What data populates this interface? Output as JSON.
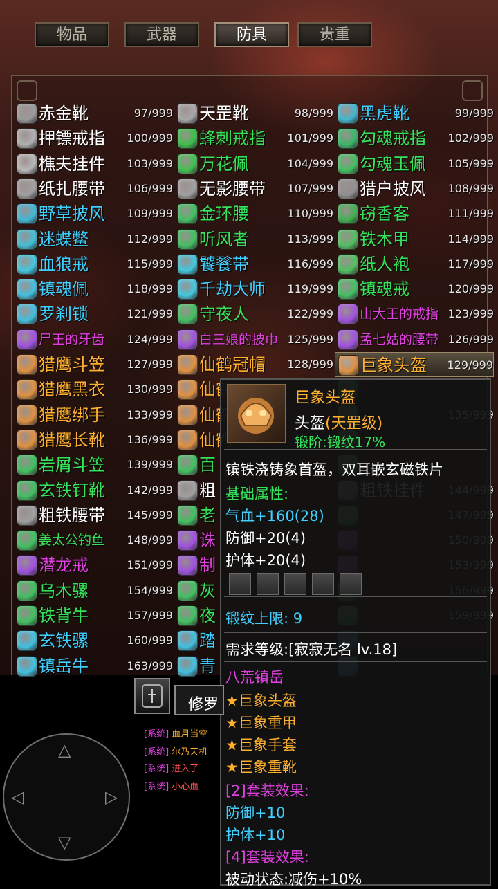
{
  "tabs": [
    "物品",
    "武器",
    "防具",
    "贵重"
  ],
  "active_tab": 2,
  "items": [
    {
      "name": "赤金靴",
      "count": "97/999",
      "color": "#ffffff",
      "icon": "#9a9a9a"
    },
    {
      "name": "天罡靴",
      "count": "98/999",
      "color": "#ffffff",
      "icon": "#a8a8a8"
    },
    {
      "name": "黑虎靴",
      "count": "99/999",
      "color": "#3fd0ff",
      "icon": "#3fb8d0"
    },
    {
      "name": "押镖戒指",
      "count": "100/999",
      "color": "#ffffff",
      "icon": "#b0b0b0"
    },
    {
      "name": "蜂刺戒指",
      "count": "101/999",
      "color": "#35e35a",
      "icon": "#39c048"
    },
    {
      "name": "勾魂戒指",
      "count": "102/999",
      "color": "#35e35a",
      "icon": "#36b868"
    },
    {
      "name": "樵夫挂件",
      "count": "103/999",
      "color": "#ffffff",
      "icon": "#b8b8b8"
    },
    {
      "name": "万花佩",
      "count": "104/999",
      "color": "#35e35a",
      "icon": "#40c050"
    },
    {
      "name": "勾魂玉佩",
      "count": "105/999",
      "color": "#35e35a",
      "icon": "#40c060"
    },
    {
      "name": "纸扎腰带",
      "count": "106/999",
      "color": "#ffffff",
      "icon": "#a0a0a0"
    },
    {
      "name": "无影腰带",
      "count": "107/999",
      "color": "#ffffff",
      "icon": "#a0a0a0"
    },
    {
      "name": "猎户披风",
      "count": "108/999",
      "color": "#ffffff",
      "icon": "#909090"
    },
    {
      "name": "野草披风",
      "count": "109/999",
      "color": "#3fd0ff",
      "icon": "#40b8d8"
    },
    {
      "name": "金环腰",
      "count": "110/999",
      "color": "#35e35a",
      "icon": "#40c060"
    },
    {
      "name": "窃香客",
      "count": "111/999",
      "color": "#35e35a",
      "icon": "#40b050"
    },
    {
      "name": "迷蝶鳖",
      "count": "112/999",
      "color": "#3fd0ff",
      "icon": "#40c0d8"
    },
    {
      "name": "听风者",
      "count": "113/999",
      "color": "#35e35a",
      "icon": "#40c060"
    },
    {
      "name": "铁木甲",
      "count": "114/999",
      "color": "#35e35a",
      "icon": "#50c060"
    },
    {
      "name": "血狼戒",
      "count": "115/999",
      "color": "#3fd0ff",
      "icon": "#40c8e0"
    },
    {
      "name": "饕餮带",
      "count": "116/999",
      "color": "#3fd0ff",
      "icon": "#40c8e0"
    },
    {
      "name": "纸人袍",
      "count": "117/999",
      "color": "#35e35a",
      "icon": "#50c060"
    },
    {
      "name": "镇魂佩",
      "count": "118/999",
      "color": "#3fd0ff",
      "icon": "#40c0e0"
    },
    {
      "name": "千劫大师",
      "count": "119/999",
      "color": "#3fd0ff",
      "icon": "#40c8e0"
    },
    {
      "name": "镇魂戒",
      "count": "120/999",
      "color": "#35e35a",
      "icon": "#40c060"
    },
    {
      "name": "罗刹锁",
      "count": "121/999",
      "color": "#3fd0ff",
      "icon": "#40c0e0"
    },
    {
      "name": "守夜人",
      "count": "122/999",
      "color": "#35e35a",
      "icon": "#40c060"
    },
    {
      "name": "山大王的戒指",
      "count": "123/999",
      "color": "#e040e0",
      "icon": "#a050e0"
    },
    {
      "name": "尸王的牙齿",
      "count": "124/999",
      "color": "#e040e0",
      "icon": "#a050e0"
    },
    {
      "name": "白三娘的披巾",
      "count": "125/999",
      "color": "#e040e0",
      "icon": "#a050e0"
    },
    {
      "name": "孟七姑的腰带",
      "count": "126/999",
      "color": "#e040e0",
      "icon": "#a050e0"
    },
    {
      "name": "猎鹰斗笠",
      "count": "127/999",
      "color": "#ffb030",
      "icon": "#e09040"
    },
    {
      "name": "仙鹤冠帽",
      "count": "128/999",
      "color": "#ffb030",
      "icon": "#e09040"
    },
    {
      "name": "巨象头盔",
      "count": "129/999",
      "color": "#ffb030",
      "icon": "#e09040"
    },
    {
      "name": "猎鹰黑衣",
      "count": "130/999",
      "color": "#ffb030",
      "icon": "#e09040"
    },
    {
      "name": "仙鹤",
      "count": "",
      "color": "#ffb030",
      "icon": "#e09040"
    },
    {
      "name": "",
      "count": "",
      "color": "#35e35a",
      "icon": "#40c060"
    },
    {
      "name": "猎鹰绑手",
      "count": "133/999",
      "color": "#ffb030",
      "icon": "#e09040"
    },
    {
      "name": "仙鹤",
      "count": "",
      "color": "#ffb030",
      "icon": "#e09040"
    },
    {
      "name": "",
      "count": "135/999",
      "color": "#35e35a",
      "icon": "#40c060"
    },
    {
      "name": "猎鹰长靴",
      "count": "136/999",
      "color": "#ffb030",
      "icon": "#e09040"
    },
    {
      "name": "仙鹤",
      "count": "",
      "color": "#ffb030",
      "icon": "#e09040"
    },
    {
      "name": "",
      "count": "",
      "color": "#35e35a",
      "icon": "#40c060"
    },
    {
      "name": "岩屑斗笠",
      "count": "139/999",
      "color": "#35e35a",
      "icon": "#40c060"
    },
    {
      "name": "百",
      "count": "",
      "color": "#35e35a",
      "icon": "#40c060"
    },
    {
      "name": "",
      "count": "",
      "color": "#35e35a",
      "icon": "#40c060"
    },
    {
      "name": "玄铁钉靴",
      "count": "142/999",
      "color": "#35e35a",
      "icon": "#40c060"
    },
    {
      "name": "粗",
      "count": "",
      "color": "#ffffff",
      "icon": "#a0a0a0"
    },
    {
      "name": "粗铁挂件",
      "count": "144/999",
      "color": "#ffffff",
      "icon": "#a0a0a0"
    },
    {
      "name": "粗铁腰带",
      "count": "145/999",
      "color": "#ffffff",
      "icon": "#a0a0a0"
    },
    {
      "name": "老",
      "count": "",
      "color": "#35e35a",
      "icon": "#40c060"
    },
    {
      "name": "",
      "count": "147/999",
      "color": "#35e35a",
      "icon": "#40c060"
    },
    {
      "name": "姜太公钓鱼",
      "count": "148/999",
      "color": "#35e35a",
      "icon": "#40c060"
    },
    {
      "name": "诛",
      "count": "",
      "color": "#e040e0",
      "icon": "#a050e0"
    },
    {
      "name": "",
      "count": "150/999",
      "color": "#e040e0",
      "icon": "#a050e0"
    },
    {
      "name": "潜龙戒",
      "count": "151/999",
      "color": "#e040e0",
      "icon": "#a050e0"
    },
    {
      "name": "制",
      "count": "",
      "color": "#e040e0",
      "icon": "#a050e0"
    },
    {
      "name": "",
      "count": "153/999",
      "color": "#e040e0",
      "icon": "#a050e0"
    },
    {
      "name": "乌木骡",
      "count": "154/999",
      "color": "#35e35a",
      "icon": "#40c060"
    },
    {
      "name": "灰",
      "count": "",
      "color": "#35e35a",
      "icon": "#40c060"
    },
    {
      "name": "",
      "count": "156/999",
      "color": "#35e35a",
      "icon": "#40c060"
    },
    {
      "name": "铁背牛",
      "count": "157/999",
      "color": "#35e35a",
      "icon": "#40c060"
    },
    {
      "name": "夜",
      "count": "",
      "color": "#35e35a",
      "icon": "#40c060"
    },
    {
      "name": "",
      "count": "159/999",
      "color": "#35e35a",
      "icon": "#40c060"
    },
    {
      "name": "玄铁骡",
      "count": "160/999",
      "color": "#3fd0ff",
      "icon": "#40c0e0"
    },
    {
      "name": "踏",
      "count": "",
      "color": "#3fd0ff",
      "icon": "#40c0e0"
    },
    {
      "name": "",
      "count": "",
      "color": "#3fd0ff",
      "icon": "#40c0e0"
    },
    {
      "name": "镇岳牛",
      "count": "163/999",
      "color": "#3fd0ff",
      "icon": "#40c0e0"
    },
    {
      "name": "青",
      "count": "",
      "color": "#3fd0ff",
      "icon": "#40c0e0"
    },
    {
      "name": "",
      "count": "",
      "color": "#3fd0ff",
      "icon": "#40c0e0"
    }
  ],
  "selected_index": 32,
  "tooltip": {
    "title": "巨象头盔",
    "type_label": "头盔",
    "grade": "(天罡级)",
    "forge": "锻阶:锻纹17%",
    "description": "镔铁浇铸象首盔，双耳嵌玄磁铁片",
    "base_header": "基础属性:",
    "stats": [
      "气血+160(28)",
      "防御+20(4)",
      "护体+20(4)"
    ],
    "forge_limit": "锻纹上限: 9",
    "require": "需求等级:[寂寂无名 lv.18]",
    "set_name": "八荒镇岳",
    "set_items": [
      "★巨象头盔",
      "★巨象重甲",
      "★巨象手套",
      "★巨象重靴"
    ],
    "set2_header": "[2]套装效果:",
    "set2_effects": [
      "防御+10",
      "护体+10"
    ],
    "set4_header": "[4]套装效果:",
    "set4_effect": "被动状态:减伤+10%"
  },
  "hud": {
    "player_name": "修罗",
    "chat": [
      {
        "tag": "[系统]",
        "text": "血月当空"
      },
      {
        "tag": "[系统]",
        "text": "尔乃天机"
      },
      {
        "tag": "[系统]",
        "text": "进入了"
      },
      {
        "tag": "[系统]",
        "text": "小心血"
      }
    ]
  }
}
